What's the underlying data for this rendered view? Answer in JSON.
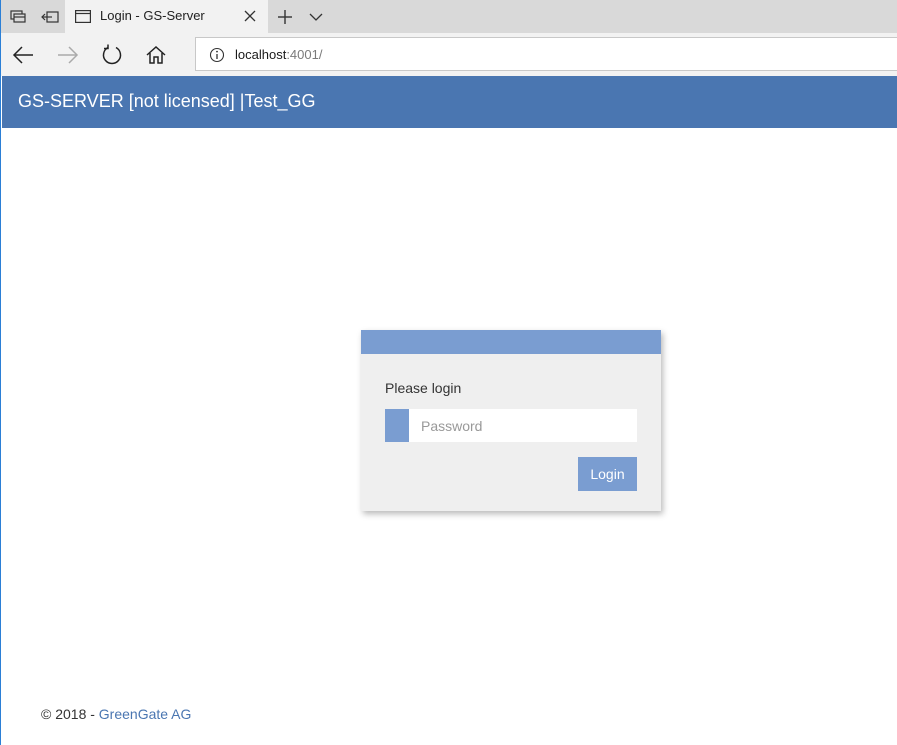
{
  "browser": {
    "tab": {
      "title": "Login - GS-Server"
    },
    "address": {
      "host": "localhost",
      "rest": ":4001/"
    }
  },
  "app": {
    "title": "GS-SERVER [not licensed] |Test_GG"
  },
  "login": {
    "prompt": "Please login",
    "password_placeholder": "Password",
    "button_label": "Login"
  },
  "footer": {
    "copyright": "© 2018 - ",
    "company": "GreenGate AG"
  },
  "colors": {
    "header": "#4a76b1",
    "accent": "#7a9dd1",
    "link": "#4a76b1"
  },
  "icons": [
    "tab-preview-icon",
    "set-aside-tabs-icon",
    "page-icon",
    "close-icon",
    "plus-icon",
    "chevron-down-icon",
    "back-arrow-icon",
    "forward-arrow-icon",
    "refresh-icon",
    "home-icon",
    "info-icon"
  ]
}
